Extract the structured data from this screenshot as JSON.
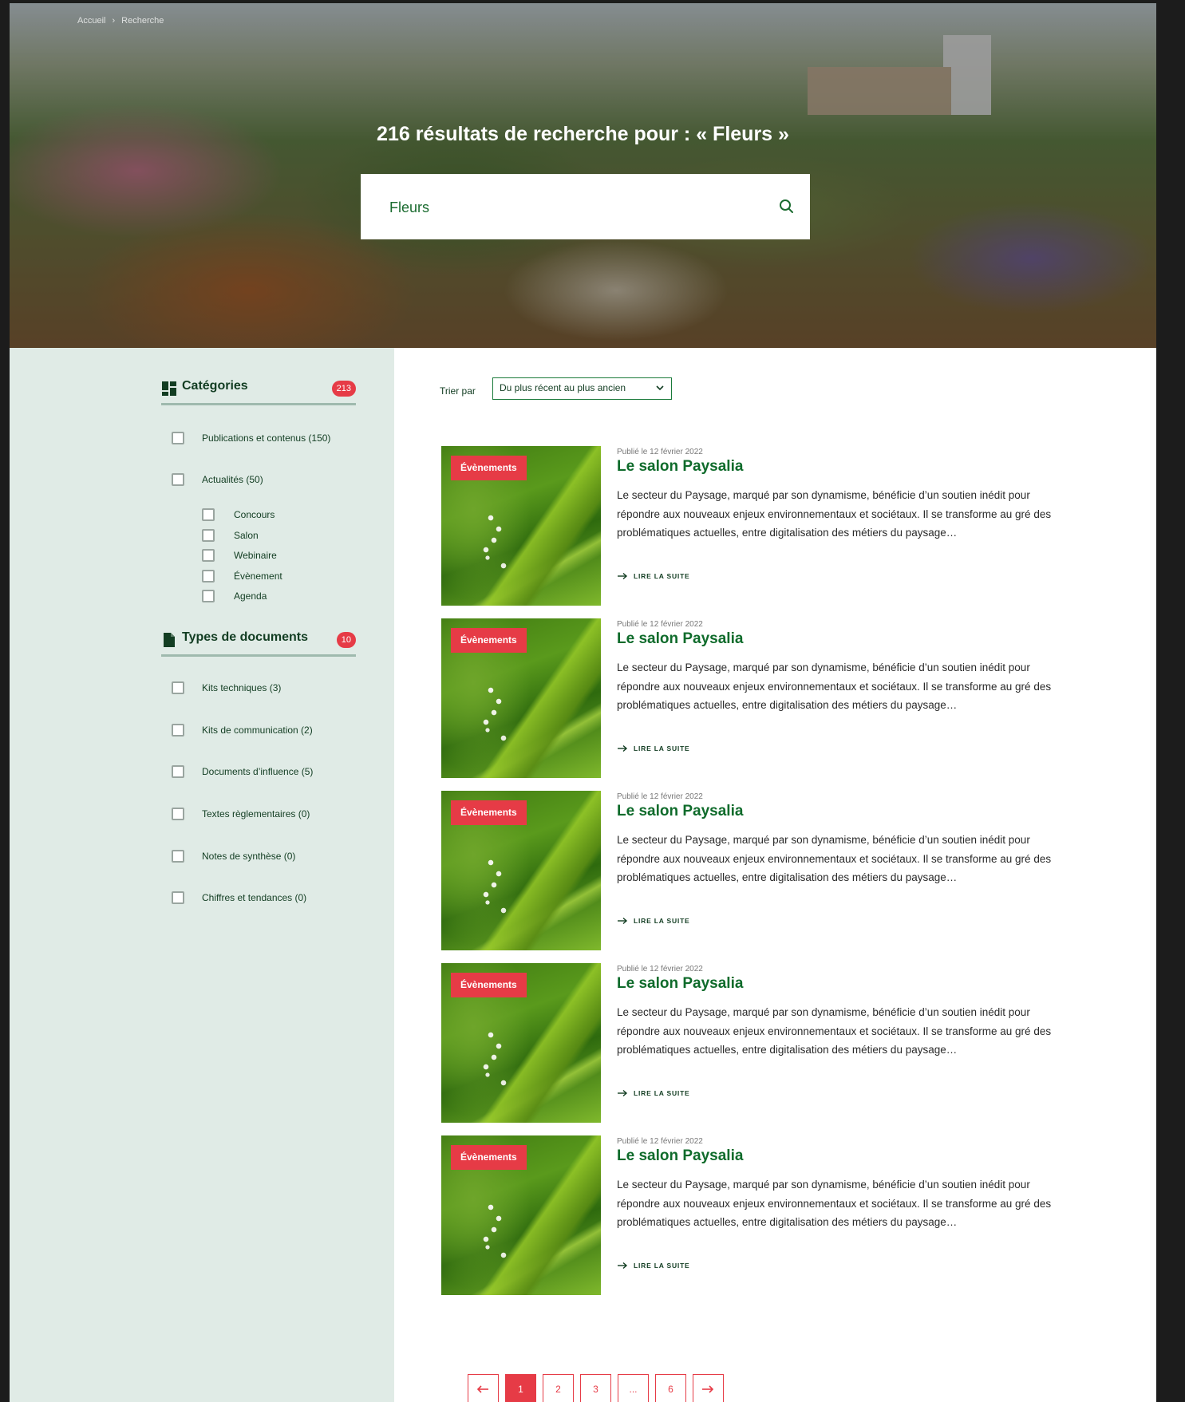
{
  "breadcrumb": {
    "home": "Accueil",
    "current": "Recherche"
  },
  "hero": {
    "title": "216 résultats de recherche pour : « Fleurs »",
    "search_value": "Fleurs"
  },
  "sidebar": {
    "categories": {
      "title": "Catégories",
      "count": "213",
      "items": [
        "Publications et contenus (150)",
        "Actualités (50)"
      ],
      "sub_items": [
        "Concours",
        "Salon",
        "Webinaire",
        "Évènement",
        "Agenda"
      ]
    },
    "doc_types": {
      "title": "Types de documents",
      "count": "10",
      "items": [
        "Kits techniques (3)",
        "Kits de communication (2)",
        "Documents d’influence (5)",
        "Textes règlementaires (0)",
        "Notes de synthèse (0)",
        "Chiffres et tendances (0)"
      ]
    }
  },
  "sort": {
    "label": "Trier par",
    "selected": "Du plus récent au plus ancien"
  },
  "results": [
    {
      "tag": "Évènements",
      "date": "Publié le 12 février 2022",
      "title": "Le salon Paysalia",
      "excerpt": "Le secteur du Paysage, marqué par son dynamisme, bénéficie d’un soutien inédit pour répondre aux nouveaux enjeux environnementaux et sociétaux. Il se transforme au gré des problématiques actuelles, entre digitalisation des métiers du paysage…",
      "more": "LIRE LA SUITE"
    },
    {
      "tag": "Évènements",
      "date": "Publié le 12 février 2022",
      "title": "Le salon Paysalia",
      "excerpt": "Le secteur du Paysage, marqué par son dynamisme, bénéficie d’un soutien inédit pour répondre aux nouveaux enjeux environnementaux et sociétaux. Il se transforme au gré des problématiques actuelles, entre digitalisation des métiers du paysage…",
      "more": "LIRE LA SUITE"
    },
    {
      "tag": "Évènements",
      "date": "Publié le 12 février 2022",
      "title": "Le salon Paysalia",
      "excerpt": "Le secteur du Paysage, marqué par son dynamisme, bénéficie d’un soutien inédit pour répondre aux nouveaux enjeux environnementaux et sociétaux. Il se transforme au gré des problématiques actuelles, entre digitalisation des métiers du paysage…",
      "more": "LIRE LA SUITE"
    },
    {
      "tag": "Évènements",
      "date": "Publié le 12 février 2022",
      "title": "Le salon Paysalia",
      "excerpt": "Le secteur du Paysage, marqué par son dynamisme, bénéficie d’un soutien inédit pour répondre aux nouveaux enjeux environnementaux et sociétaux. Il se transforme au gré des problématiques actuelles, entre digitalisation des métiers du paysage…",
      "more": "LIRE LA SUITE"
    },
    {
      "tag": "Évènements",
      "date": "Publié le 12 février 2022",
      "title": "Le salon Paysalia",
      "excerpt": "Le secteur du Paysage, marqué par son dynamisme, bénéficie d’un soutien inédit pour répondre aux nouveaux enjeux environnementaux et sociétaux. Il se transforme au gré des problématiques actuelles, entre digitalisation des métiers du paysage…",
      "more": "LIRE LA SUITE"
    }
  ],
  "pagination": {
    "pages": [
      "1",
      "2",
      "3",
      "...",
      "6"
    ],
    "current": "1"
  },
  "colors": {
    "accent": "#e63b46",
    "brand_green": "#0f6b2b",
    "sidebar_bg": "#e0ebe6"
  }
}
